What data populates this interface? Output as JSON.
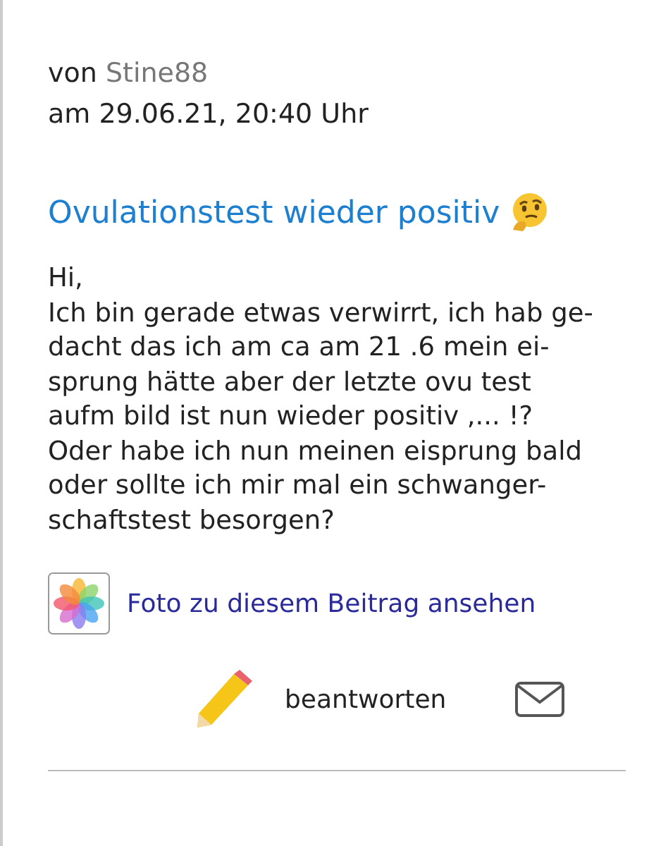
{
  "post": {
    "author_prefix": "von",
    "author": "Stine88",
    "date": "am 29.06.21, 20:40 Uhr",
    "title": "Ovulationstest wieder positiv",
    "body": "Hi,\nIch bin gerade etwas verwirrt, ich hab ge-\ndacht das ich am ca am 21 .6 mein ei-\nsprung hätte aber der letzte ovu test\naufm bild ist nun wieder positiv ,... !?\nOder habe ich nun meinen eisprung bald\noder sollte ich mir mal ein schwanger-\nschaftstest besorgen?",
    "photo_link": "Foto zu diesem Beitrag ansehen",
    "reply": "beantworten"
  }
}
